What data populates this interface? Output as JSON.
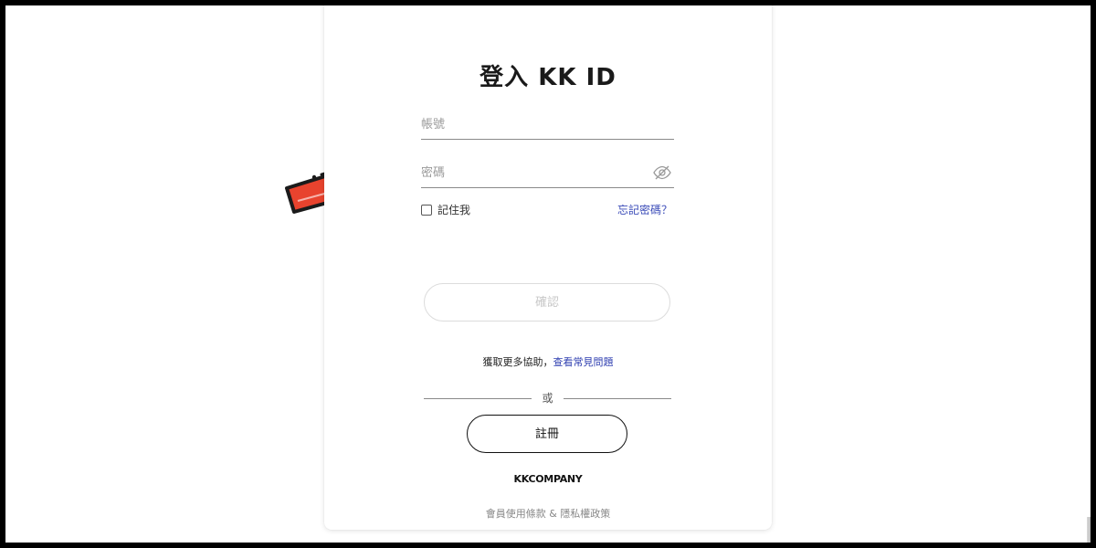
{
  "login": {
    "title": "登入 KK ID",
    "username_placeholder": "帳號",
    "password_placeholder": "密碼",
    "remember_label": "記住我",
    "forgot_link": "忘記密碼？",
    "confirm_button": "確認",
    "help_text": "獲取更多協助，",
    "help_link": "查看常見問題",
    "or_text": "或",
    "register_button": "註冊",
    "brand": "KKCOMPANY",
    "terms_link": "會員使用條款",
    "legal_separator": " & ",
    "privacy_link": "隱私權政策"
  },
  "icons": {
    "password_visibility": "eye-slash-icon",
    "annotation": "red-arrow-icon"
  },
  "colors": {
    "link": "#3a4bb8",
    "arrow": "#e8432e",
    "disabled_text": "#c8c8c8"
  }
}
